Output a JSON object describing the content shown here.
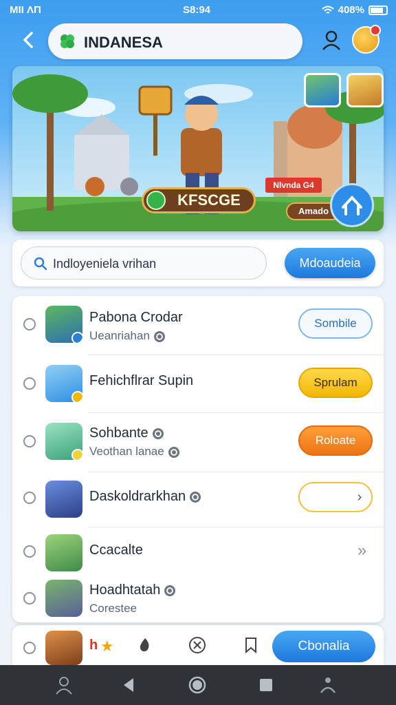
{
  "status_bar": {
    "carrier": "MII ΛΠ",
    "time": "S8:94",
    "battery": "408%"
  },
  "header": {
    "title": "INDANESA",
    "back_icon": "back-arrow-icon",
    "user_icon": "user-icon"
  },
  "banner": {
    "badge_text": "KFSCGE",
    "red_tag": "Nlvnda G4",
    "small_pill": "Amado"
  },
  "search": {
    "value": "Indloyeniela vrihan",
    "button_label": "Mdoaudeia"
  },
  "list": {
    "items": [
      {
        "title": "Pabona Crodar",
        "subtitle": "Ueanriahan",
        "action": "Sombile",
        "action_style": "outline-blue"
      },
      {
        "title": "Fehichflrar Supin",
        "subtitle": "",
        "action": "Sprulam",
        "action_style": "yellow"
      },
      {
        "title": "Sohbante",
        "subtitle": "Veothan lanae",
        "action": "Roloate",
        "action_style": "orange"
      },
      {
        "title": "Daskoldrarkhan",
        "subtitle": "",
        "action": "›",
        "action_style": "outline-yellow"
      },
      {
        "title": "Ccacalte",
        "subtitle": "",
        "action": "»",
        "action_style": "chevron"
      },
      {
        "title": "Hoadhtatah",
        "subtitle": "Corestee",
        "action": "",
        "action_style": "none"
      }
    ]
  },
  "bottom_bar": {
    "text": "h",
    "button_label": "Cbonalia"
  },
  "colors": {
    "primary": "#1d79dc",
    "accent_yellow": "#f2b705",
    "accent_orange": "#ee7413",
    "nav_bg": "#2f3338"
  }
}
